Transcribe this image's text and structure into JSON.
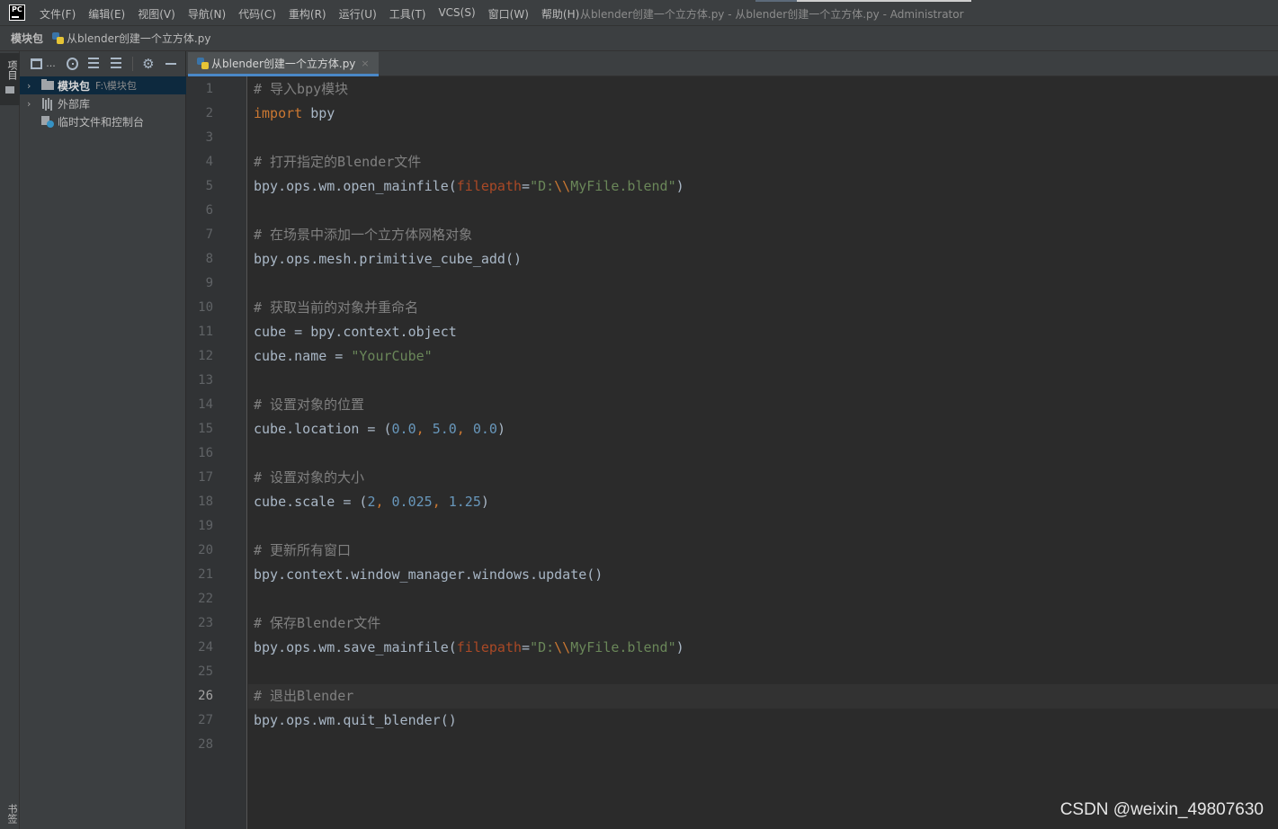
{
  "app": {
    "logo_text": "PC",
    "menu": [
      "文件(F)",
      "编辑(E)",
      "视图(V)",
      "导航(N)",
      "代码(C)",
      "重构(R)",
      "运行(U)",
      "工具(T)",
      "VCS(S)",
      "窗口(W)",
      "帮助(H)"
    ],
    "window_title": "从blender创建一个立方体.py - 从blender创建一个立方体.py - Administrator"
  },
  "breadcrumb": {
    "root": "模块包",
    "file": "从blender创建一个立方体.py"
  },
  "tool_strip": {
    "project_label": "项目",
    "bookmark_label": "书签"
  },
  "project_panel": {
    "view_dots": "...",
    "tree": [
      {
        "label": "模块包",
        "path": "F:\\模块包",
        "expanded": false,
        "selected": true,
        "icon": "folder-icon"
      },
      {
        "label": "外部库",
        "path": "",
        "expanded": false,
        "selected": false,
        "icon": "library-icon"
      },
      {
        "label": "临时文件和控制台",
        "path": "",
        "expanded": null,
        "selected": false,
        "icon": "scratch-icon"
      }
    ]
  },
  "editor": {
    "tab_label": "从blender创建一个立方体.py",
    "close_glyph": "×",
    "current_line": 26,
    "lines": [
      [
        [
          "c",
          "# 导入bpy模块"
        ]
      ],
      [
        [
          "k",
          "import"
        ],
        [
          "i",
          " bpy"
        ]
      ],
      [],
      [
        [
          "c",
          "# 打开指定的Blender文件"
        ]
      ],
      [
        [
          "i",
          "bpy.ops.wm.open_mainfile("
        ],
        [
          "p",
          "filepath"
        ],
        [
          "i",
          "="
        ],
        [
          "s",
          "\"D:"
        ],
        [
          "e",
          "\\\\"
        ],
        [
          "s",
          "MyFile.blend\""
        ],
        [
          "i",
          ")"
        ]
      ],
      [],
      [
        [
          "c",
          "# 在场景中添加一个立方体网格对象"
        ]
      ],
      [
        [
          "i",
          "bpy.ops.mesh.primitive_cube_add()"
        ]
      ],
      [],
      [
        [
          "c",
          "# 获取当前的对象并重命名"
        ]
      ],
      [
        [
          "i",
          "cube = bpy.context.object"
        ]
      ],
      [
        [
          "i",
          "cube.name = "
        ],
        [
          "s",
          "\"YourCube\""
        ]
      ],
      [],
      [
        [
          "c",
          "# 设置对象的位置"
        ]
      ],
      [
        [
          "i",
          "cube.location = ("
        ],
        [
          "n",
          "0.0"
        ],
        [
          "u",
          ", "
        ],
        [
          "n",
          "5.0"
        ],
        [
          "u",
          ", "
        ],
        [
          "n",
          "0.0"
        ],
        [
          "i",
          ")"
        ]
      ],
      [],
      [
        [
          "c",
          "# 设置对象的大小"
        ]
      ],
      [
        [
          "i",
          "cube.scale = ("
        ],
        [
          "n",
          "2"
        ],
        [
          "u",
          ", "
        ],
        [
          "n",
          "0.025"
        ],
        [
          "u",
          ", "
        ],
        [
          "n",
          "1.25"
        ],
        [
          "i",
          ")"
        ]
      ],
      [],
      [
        [
          "c",
          "# 更新所有窗口"
        ]
      ],
      [
        [
          "i",
          "bpy.context.window_manager.windows.update()"
        ]
      ],
      [],
      [
        [
          "c",
          "# 保存Blender文件"
        ]
      ],
      [
        [
          "i",
          "bpy.ops.wm.save_mainfile("
        ],
        [
          "p",
          "filepath"
        ],
        [
          "i",
          "="
        ],
        [
          "s",
          "\"D:"
        ],
        [
          "e",
          "\\\\"
        ],
        [
          "s",
          "MyFile.blend\""
        ],
        [
          "i",
          ")"
        ]
      ],
      [],
      [
        [
          "c",
          "# 退出Blender"
        ]
      ],
      [
        [
          "i",
          "bpy.ops.wm.quit_blender()"
        ]
      ],
      []
    ]
  },
  "watermark": "CSDN @weixin_49807630",
  "colors": {
    "comment": "#808080",
    "keyword": "#cc7832",
    "identifier": "#a9b7c6",
    "named_param": "#aa4926",
    "string": "#6a8759",
    "number": "#6897bb",
    "background": "#2b2b2b"
  }
}
